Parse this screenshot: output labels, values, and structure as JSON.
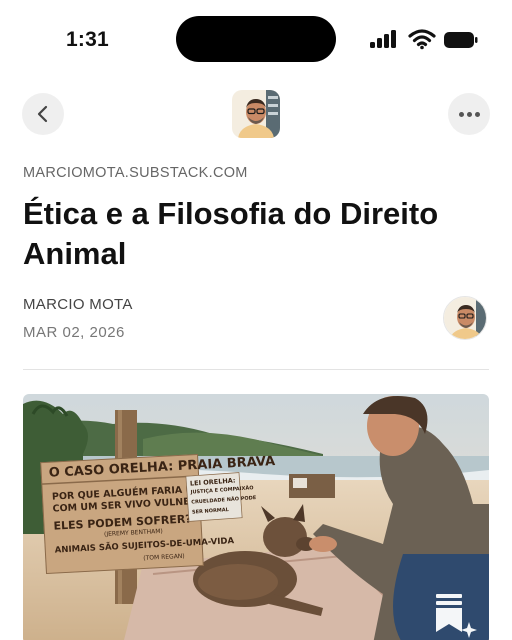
{
  "status_bar": {
    "time": "1:31"
  },
  "nav": {
    "back_icon": "chevron-left-icon",
    "more_icon": "more-horizontal-icon"
  },
  "article": {
    "publication_domain": "MARCIOMOTA.SUBSTACK.COM",
    "title": "Ética e a Filosofia do Direito Animal",
    "author": "MARCIO MOTA",
    "date": "MAR 02, 2026"
  },
  "hero_image": {
    "sign_main": {
      "title": "O CASO ORELHA: PRAIA BRAVA",
      "line1": "POR QUE ALGUÉM FARIA ISSO",
      "line2": "COM UM SER VIVO VULNERÁVEL?",
      "line3": "ELES PODEM SOFRER?",
      "quote1": "(JEREMY BENTHAM)",
      "line4": "ANIMAIS SÃO SUJEITOS-DE-UMA-VIDA",
      "quote2": "(TOM REGAN)"
    },
    "sign_side": {
      "line1": "LEI ORELHA:",
      "line2": "JUSTIÇA E COMPAIXÃO",
      "line3": "CRUELDADE NÃO PODE",
      "line4": "SER NORMAL"
    }
  },
  "colors": {
    "accent_background": "#efefef",
    "divider": "#e3e3e3",
    "muted_text": "#666666"
  }
}
